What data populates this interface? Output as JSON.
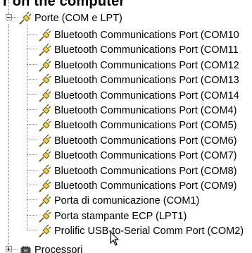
{
  "heading_fragment": "r on the computer",
  "tree": {
    "ports_category": {
      "label": "Porte (COM e LPT)",
      "icon": "port-connector-icon",
      "expanded": true
    },
    "port_items": [
      {
        "label": "Bluetooth Communications Port (COM10",
        "icon": "port-connector-icon"
      },
      {
        "label": "Bluetooth Communications Port (COM11",
        "icon": "port-connector-icon"
      },
      {
        "label": "Bluetooth Communications Port (COM12",
        "icon": "port-connector-icon"
      },
      {
        "label": "Bluetooth Communications Port (COM13",
        "icon": "port-connector-icon"
      },
      {
        "label": "Bluetooth Communications Port (COM14",
        "icon": "port-connector-icon"
      },
      {
        "label": "Bluetooth Communications Port (COM4)",
        "icon": "port-connector-icon"
      },
      {
        "label": "Bluetooth Communications Port (COM5)",
        "icon": "port-connector-icon"
      },
      {
        "label": "Bluetooth Communications Port (COM6)",
        "icon": "port-connector-icon"
      },
      {
        "label": "Bluetooth Communications Port (COM7)",
        "icon": "port-connector-icon"
      },
      {
        "label": "Bluetooth Communications Port (COM8)",
        "icon": "port-connector-icon"
      },
      {
        "label": "Bluetooth Communications Port (COM9)",
        "icon": "port-connector-icon"
      },
      {
        "label": "Porta di comunicazione (COM1)",
        "icon": "port-connector-icon"
      },
      {
        "label": "Porta stampante ECP (LPT1)",
        "icon": "port-connector-icon"
      },
      {
        "label": "Prolific USB-to-Serial Comm Port (COM2)",
        "icon": "port-connector-icon"
      }
    ],
    "processors_category": {
      "label": "Processori",
      "icon": "processor-chip-icon",
      "expanded": false
    }
  },
  "colors": {
    "background": "#ffffff",
    "text": "#000000",
    "tree_lines": "#808080",
    "port_icon_body": "#f0d24a",
    "port_icon_outline": "#6b5a10"
  }
}
